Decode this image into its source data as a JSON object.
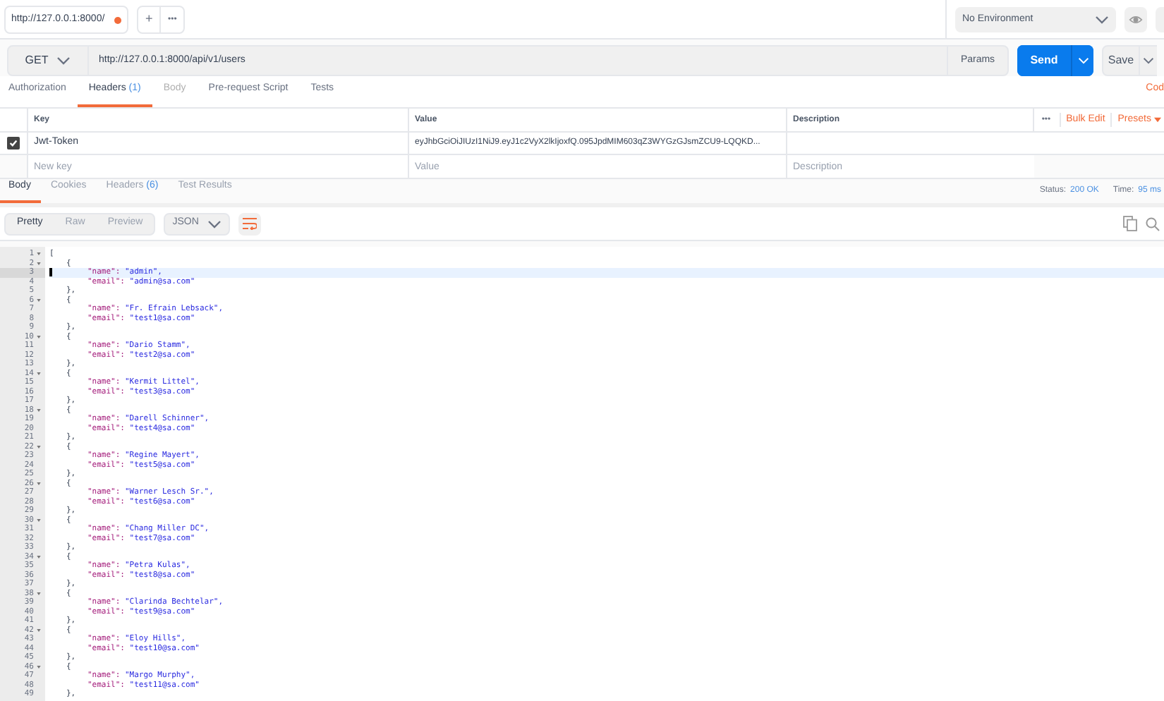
{
  "tabs": [
    {
      "label": "http://127.0.0.1:8000/",
      "unsaved": true,
      "selected": true
    }
  ],
  "tab_actions": {
    "add": "+",
    "more": "•••"
  },
  "environment": {
    "value": "No Environment"
  },
  "request": {
    "method": "GET",
    "url": "http://127.0.0.1:8000/api/v1/users",
    "params": "Params",
    "send": "Send",
    "save": "Save"
  },
  "request_tabs": [
    {
      "label": "Authorization",
      "selected": false,
      "disabled": false
    },
    {
      "label": "Headers",
      "count": "(1)",
      "selected": true,
      "disabled": false
    },
    {
      "label": "Body",
      "selected": false,
      "disabled": true
    },
    {
      "label": "Pre-request Script",
      "selected": false,
      "disabled": false
    },
    {
      "label": "Tests",
      "selected": false,
      "disabled": false
    }
  ],
  "code_link": "Cod",
  "headers_table": {
    "columns": [
      "Key",
      "Value",
      "Description"
    ],
    "more": "•••",
    "bulk_edit": "Bulk Edit",
    "presets": "Presets",
    "rows": [
      {
        "checked": true,
        "key": "Jwt-Token",
        "value": "eyJhbGciOiJIUzI1NiJ9.eyJ1c2VyX2lkIjoxfQ.095JpdMIM603qZ3WYGzGJsmZCU9-LQQKD..."
      }
    ],
    "new_row": {
      "key_placeholder": "New key",
      "value_placeholder": "Value",
      "description_placeholder": "Description"
    }
  },
  "response_tabs": [
    {
      "label": "Body",
      "selected": true
    },
    {
      "label": "Cookies",
      "selected": false
    },
    {
      "label": "Headers",
      "count": "(6)",
      "selected": false
    },
    {
      "label": "Test Results",
      "selected": false
    }
  ],
  "status": {
    "label": "Status:",
    "value": "200 OK"
  },
  "time": {
    "label": "Time:",
    "value": "95 ms"
  },
  "view_modes": [
    {
      "label": "Pretty",
      "selected": true
    },
    {
      "label": "Raw",
      "selected": false
    },
    {
      "label": "Preview",
      "selected": false
    }
  ],
  "format": "JSON",
  "code_lines": [
    {
      "number": "1",
      "kind": "array",
      "text": "[",
      "fold": true,
      "active": false
    },
    {
      "number": "2",
      "kind": "object",
      "text": "{",
      "fold": true,
      "active": false
    },
    {
      "number": "3",
      "kind": "pair",
      "key": "\"name\":",
      "value": "\"admin\",",
      "fold": false,
      "active": true
    },
    {
      "number": "4",
      "kind": "pair",
      "key": "\"email\":",
      "value": "\"admin@sa.com\"",
      "fold": false,
      "active": false
    },
    {
      "number": "5",
      "kind": "object",
      "text": "},",
      "fold": false,
      "active": false
    },
    {
      "number": "6",
      "kind": "object",
      "text": "{",
      "fold": true,
      "active": false
    },
    {
      "number": "7",
      "kind": "pair",
      "key": "\"name\":",
      "value": "\"Fr. Efrain Lebsack\",",
      "fold": false,
      "active": false
    },
    {
      "number": "8",
      "kind": "pair",
      "key": "\"email\":",
      "value": "\"test1@sa.com\"",
      "fold": false,
      "active": false
    },
    {
      "number": "9",
      "kind": "object",
      "text": "},",
      "fold": false,
      "active": false
    },
    {
      "number": "10",
      "kind": "object",
      "text": "{",
      "fold": true,
      "active": false
    },
    {
      "number": "11",
      "kind": "pair",
      "key": "\"name\":",
      "value": "\"Dario Stamm\",",
      "fold": false,
      "active": false
    },
    {
      "number": "12",
      "kind": "pair",
      "key": "\"email\":",
      "value": "\"test2@sa.com\"",
      "fold": false,
      "active": false
    },
    {
      "number": "13",
      "kind": "object",
      "text": "},",
      "fold": false,
      "active": false
    },
    {
      "number": "14",
      "kind": "object",
      "text": "{",
      "fold": true,
      "active": false
    },
    {
      "number": "15",
      "kind": "pair",
      "key": "\"name\":",
      "value": "\"Kermit Littel\",",
      "fold": false,
      "active": false
    },
    {
      "number": "16",
      "kind": "pair",
      "key": "\"email\":",
      "value": "\"test3@sa.com\"",
      "fold": false,
      "active": false
    },
    {
      "number": "17",
      "kind": "object",
      "text": "},",
      "fold": false,
      "active": false
    },
    {
      "number": "18",
      "kind": "object",
      "text": "{",
      "fold": true,
      "active": false
    },
    {
      "number": "19",
      "kind": "pair",
      "key": "\"name\":",
      "value": "\"Darell Schinner\",",
      "fold": false,
      "active": false
    },
    {
      "number": "20",
      "kind": "pair",
      "key": "\"email\":",
      "value": "\"test4@sa.com\"",
      "fold": false,
      "active": false
    },
    {
      "number": "21",
      "kind": "object",
      "text": "},",
      "fold": false,
      "active": false
    },
    {
      "number": "22",
      "kind": "object",
      "text": "{",
      "fold": true,
      "active": false
    },
    {
      "number": "23",
      "kind": "pair",
      "key": "\"name\":",
      "value": "\"Regine Mayert\",",
      "fold": false,
      "active": false
    },
    {
      "number": "24",
      "kind": "pair",
      "key": "\"email\":",
      "value": "\"test5@sa.com\"",
      "fold": false,
      "active": false
    },
    {
      "number": "25",
      "kind": "object",
      "text": "},",
      "fold": false,
      "active": false
    },
    {
      "number": "26",
      "kind": "object",
      "text": "{",
      "fold": true,
      "active": false
    },
    {
      "number": "27",
      "kind": "pair",
      "key": "\"name\":",
      "value": "\"Warner Lesch Sr.\",",
      "fold": false,
      "active": false
    },
    {
      "number": "28",
      "kind": "pair",
      "key": "\"email\":",
      "value": "\"test6@sa.com\"",
      "fold": false,
      "active": false
    },
    {
      "number": "29",
      "kind": "object",
      "text": "},",
      "fold": false,
      "active": false
    },
    {
      "number": "30",
      "kind": "object",
      "text": "{",
      "fold": true,
      "active": false
    },
    {
      "number": "31",
      "kind": "pair",
      "key": "\"name\":",
      "value": "\"Chang Miller DC\",",
      "fold": false,
      "active": false
    },
    {
      "number": "32",
      "kind": "pair",
      "key": "\"email\":",
      "value": "\"test7@sa.com\"",
      "fold": false,
      "active": false
    },
    {
      "number": "33",
      "kind": "object",
      "text": "},",
      "fold": false,
      "active": false
    },
    {
      "number": "34",
      "kind": "object",
      "text": "{",
      "fold": true,
      "active": false
    },
    {
      "number": "35",
      "kind": "pair",
      "key": "\"name\":",
      "value": "\"Petra Kulas\",",
      "fold": false,
      "active": false
    },
    {
      "number": "36",
      "kind": "pair",
      "key": "\"email\":",
      "value": "\"test8@sa.com\"",
      "fold": false,
      "active": false
    },
    {
      "number": "37",
      "kind": "object",
      "text": "},",
      "fold": false,
      "active": false
    },
    {
      "number": "38",
      "kind": "object",
      "text": "{",
      "fold": true,
      "active": false
    },
    {
      "number": "39",
      "kind": "pair",
      "key": "\"name\":",
      "value": "\"Clarinda Bechtelar\",",
      "fold": false,
      "active": false
    },
    {
      "number": "40",
      "kind": "pair",
      "key": "\"email\":",
      "value": "\"test9@sa.com\"",
      "fold": false,
      "active": false
    },
    {
      "number": "41",
      "kind": "object",
      "text": "},",
      "fold": false,
      "active": false
    },
    {
      "number": "42",
      "kind": "object",
      "text": "{",
      "fold": true,
      "active": false
    },
    {
      "number": "43",
      "kind": "pair",
      "key": "\"name\":",
      "value": "\"Eloy Hills\",",
      "fold": false,
      "active": false
    },
    {
      "number": "44",
      "kind": "pair",
      "key": "\"email\":",
      "value": "\"test10@sa.com\"",
      "fold": false,
      "active": false
    },
    {
      "number": "45",
      "kind": "object",
      "text": "},",
      "fold": false,
      "active": false
    },
    {
      "number": "46",
      "kind": "object",
      "text": "{",
      "fold": true,
      "active": false
    },
    {
      "number": "47",
      "kind": "pair",
      "key": "\"name\":",
      "value": "\"Margo Murphy\",",
      "fold": false,
      "active": false
    },
    {
      "number": "48",
      "kind": "pair",
      "key": "\"email\":",
      "value": "\"test11@sa.com\"",
      "fold": false,
      "active": false
    },
    {
      "number": "49",
      "kind": "object",
      "text": "},",
      "fold": false,
      "active": false
    }
  ]
}
